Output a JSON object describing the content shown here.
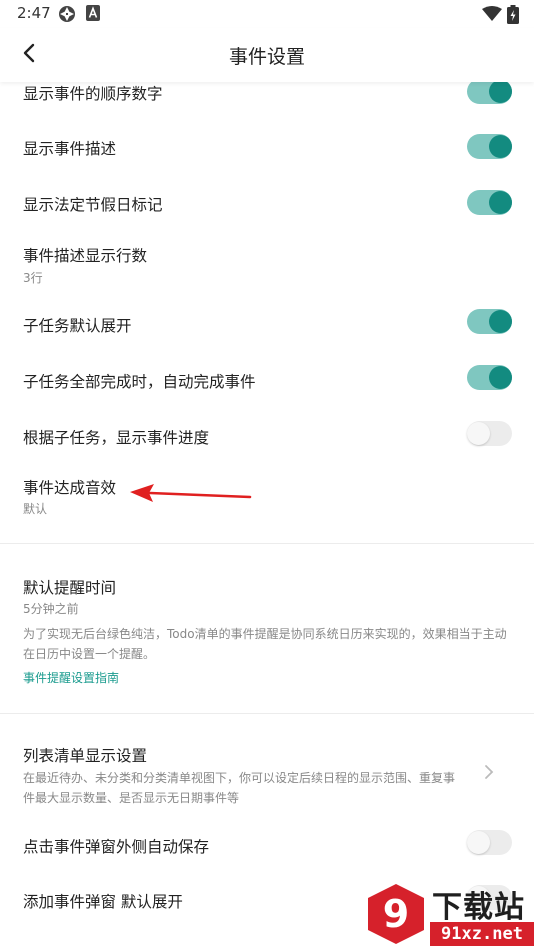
{
  "status_bar": {
    "time": "2:47",
    "icons": [
      "aperture-icon",
      "a-box-icon",
      "wifi-icon",
      "battery-charging-icon"
    ]
  },
  "app_bar": {
    "title": "事件设置",
    "back_icon": "chevron-left-icon"
  },
  "settings": {
    "show_order_number": {
      "title": "显示事件的顺序数字",
      "toggle": true
    },
    "show_description": {
      "title": "显示事件描述",
      "toggle": true
    },
    "show_holiday_mark": {
      "title": "显示法定节假日标记",
      "toggle": true
    },
    "desc_lines": {
      "title": "事件描述显示行数",
      "value": "3行"
    },
    "subtask_expand": {
      "title": "子任务默认展开",
      "toggle": true
    },
    "subtask_auto_complete": {
      "title": "子任务全部完成时，自动完成事件",
      "toggle": true
    },
    "subtask_progress": {
      "title": "根据子任务，显示事件进度",
      "toggle": false
    },
    "complete_sound": {
      "title": "事件达成音效",
      "value": "默认"
    },
    "default_reminder": {
      "title": "默认提醒时间",
      "value": "5分钟之前",
      "description": "为了实现无后台绿色纯洁，Todo清单的事件提醒是协同系统日历来实现的，效果相当于主动在日历中设置一个提醒。",
      "link": "事件提醒设置指南"
    },
    "list_display": {
      "title": "列表清单显示设置",
      "description": "在最近待办、未分类和分类清单视图下，你可以设定后续日程的显示范围、重复事件最大显示数量、是否显示无日期事件等"
    },
    "auto_save_popup": {
      "title": "点击事件弹窗外侧自动保存",
      "toggle": false
    },
    "add_popup_expand": {
      "title": "添加事件弹窗 默认展开",
      "toggle": false
    }
  },
  "colors": {
    "accent": "#138b80",
    "accent_track": "#7fc7c0",
    "link": "#1a9b8e",
    "annotation": "#e02020"
  },
  "watermark": {
    "badge_text": "9",
    "top_text": "下载站",
    "bottom_text": "91xz.net"
  }
}
